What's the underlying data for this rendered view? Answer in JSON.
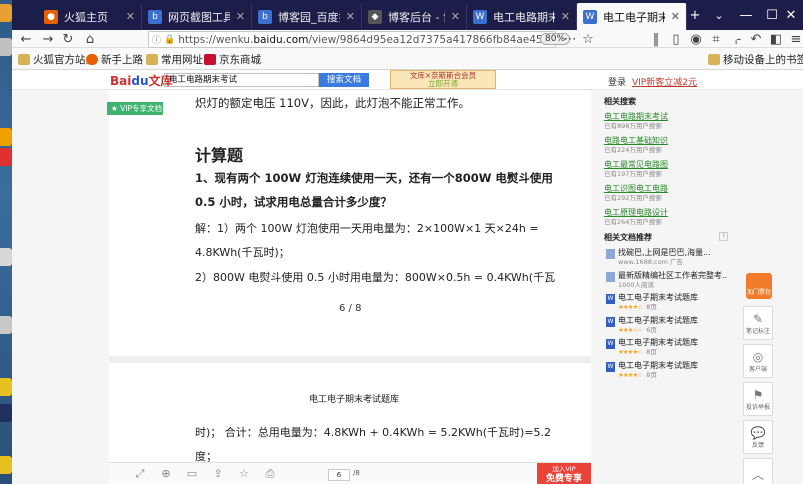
{
  "tabs": [
    {
      "label": "火狐主页",
      "color": "#e66000",
      "active": false
    },
    {
      "label": "网页截图工具_百度搜",
      "color": "#3b6fd0",
      "active": false
    },
    {
      "label": "博客园_百度搜索",
      "color": "#3b6fd0",
      "active": false
    },
    {
      "label": "博客后台 - 博客园",
      "color": "#555555",
      "active": false
    },
    {
      "label": "电工电路期末考试_百",
      "color": "#3b6fd0",
      "active": false
    },
    {
      "label": "电工电子期末考试题",
      "color": "#3b6fd0",
      "active": true
    }
  ],
  "window": {
    "new_tab": "+",
    "chevron": "⌄",
    "minimize": "—",
    "maximize": "☐",
    "close": "✕"
  },
  "nav": {
    "url_prefix": "https://wenku.",
    "url_domain": "baidu.com",
    "url_rest": "/view/9864d95ea12d7375a417866fb84ae45c3b35c2fc.h",
    "zoom": "80%"
  },
  "bookmarks": [
    {
      "label": "火狐官方站点",
      "color": "#e66000"
    },
    {
      "label": "新手上路",
      "color": "#e66000"
    },
    {
      "label": "常用网址",
      "color": "#5a5a5a"
    },
    {
      "label": "京东商城",
      "color": "#c8102e"
    },
    {
      "label": "移动设备上的书签",
      "color": "#5a5a5a"
    }
  ],
  "site": {
    "logo_bai": "Bai",
    "logo_du": "du",
    "logo_wenku": "文库",
    "search_value": "电工电路期末考试",
    "search_button": "搜索文档",
    "ad_line1": "文库×奈斯斯合会员",
    "ad_line2": "立即开通",
    "login": "登录",
    "vip_sub": "VIP新客立减2元"
  },
  "doc": {
    "vip_flag": "VIP专享文档",
    "line_top": "炽灯的额定电压 110V，因此，此灯泡不能正常工作。",
    "heading": "计算题",
    "q_line1": "1、现有两个 100W 灯泡连续使用一天，还有一个800W 电熨斗使用",
    "q_line2": "0.5 小时，试求用电总量合计多少度？",
    "a_line1": "解：1）两个  100W  灯泡使用一天用电量为：2×100W×1  天×24h  =",
    "a_line2": "4.8KWh(千瓦时)；",
    "a_line3": "2）800W 电熨斗使用 0.5 小时用电量为：800W×0.5h  =  0.4KWh(千瓦",
    "page_indicator": "6  /  8",
    "footer_title": "电工电子期末考试题库",
    "b_line1": "时)；   合计：总用电量为：4.8KWh  +  0.4KWh  =  5.2KWh(千瓦时)=5.2",
    "b_line2": "度；"
  },
  "sidebar": {
    "related_title": "相关搜索",
    "related": [
      {
        "link": "电工电路期末考试",
        "sub": "已有898万用户搜索"
      },
      {
        "link": "电路电工基础知识",
        "sub": "已有224万用户搜索"
      },
      {
        "link": "电工最常见电路图",
        "sub": "已有197万用户搜索"
      },
      {
        "link": "电工识图电工电路",
        "sub": "已有292万用户搜索"
      },
      {
        "link": "电工原理电路设计",
        "sub": "已有264万用户搜索"
      }
    ],
    "rec_title": "相关文档推荐",
    "rec_badge": "?",
    "docs": [
      {
        "icon": "img",
        "title": "找碗巴,上网是巴巴,海量...",
        "meta": "www.1688.com  广告"
      },
      {
        "icon": "img",
        "title": "最新版精编社区工作者完整考...",
        "meta": "1000人阅读"
      },
      {
        "icon": "W",
        "title": "电工电子期末考试题库",
        "stars": "★★★★☆",
        "meta": "8页"
      },
      {
        "icon": "W",
        "title": "电工电子期末考试题库",
        "stars": "★★★☆☆",
        "meta": "6页"
      },
      {
        "icon": "W",
        "title": "电工电子期末考试题库",
        "stars": "★★★★☆",
        "meta": "8页"
      },
      {
        "icon": "W",
        "title": "电工电子期末考试题库",
        "stars": "★★★★☆",
        "meta": "8页"
      }
    ]
  },
  "floatbar": {
    "red_label": "加门票包",
    "items": [
      {
        "glyph": "✎",
        "label": "笔记标注"
      },
      {
        "glyph": "◎",
        "label": "客户端"
      },
      {
        "glyph": "⚑",
        "label": "投诉举报"
      },
      {
        "glyph": "💬",
        "label": "反馈"
      },
      {
        "glyph": "︿",
        "label": ""
      }
    ]
  },
  "bottom": {
    "page_input": "6",
    "page_total": "/8",
    "vip_small": "加入VIP",
    "vip_big": "免费专享"
  }
}
